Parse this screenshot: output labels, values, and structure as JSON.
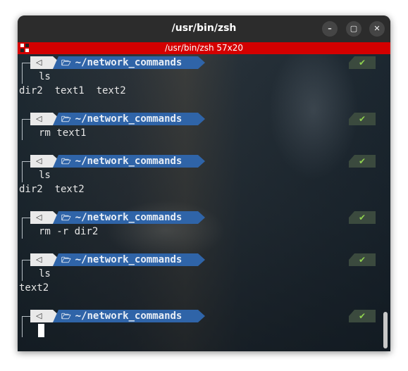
{
  "window": {
    "title": "/usr/bin/zsh",
    "controls": {
      "minimize": "–",
      "maximize": "▢",
      "close": "✕"
    }
  },
  "tab_bar": {
    "title": "/usr/bin/zsh 57x20"
  },
  "colors": {
    "tab_bar": "#d40000",
    "path_segment": "#2f64a8",
    "icon_segment": "#e9e9e9",
    "status_ok": "#8fd14f"
  },
  "prompt": {
    "os_icon": "◁",
    "folder_icon": "🗁",
    "path": "~/network_commands",
    "status_icon": "✔"
  },
  "lines": [
    {
      "type": "prompt",
      "command": "ls"
    },
    {
      "type": "output",
      "text": "dir2  text1  text2"
    },
    {
      "type": "prompt",
      "command": "rm text1"
    },
    {
      "type": "prompt",
      "command": "ls"
    },
    {
      "type": "output",
      "text": "dir2  text2"
    },
    {
      "type": "prompt",
      "command": "rm -r dir2"
    },
    {
      "type": "prompt",
      "command": "ls"
    },
    {
      "type": "output",
      "text": "text2"
    },
    {
      "type": "prompt",
      "command": ""
    }
  ]
}
